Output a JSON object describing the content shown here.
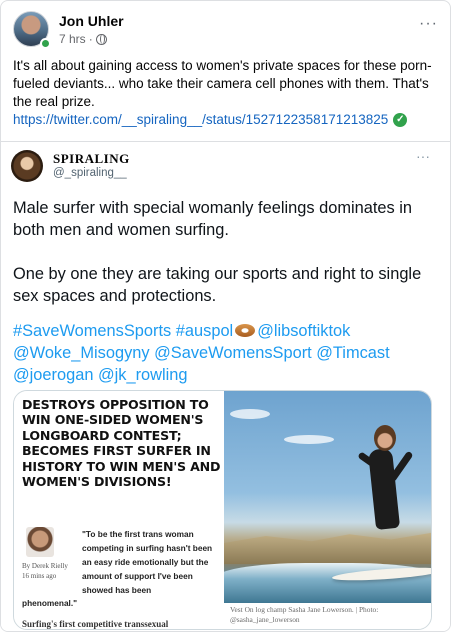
{
  "post": {
    "author": "Jon Uhler",
    "time": "7 hrs",
    "separator": "·",
    "text": "It's all about gaining access to women's private spaces for these porn-fueled deviants... who take their camera cell phones with them. That's the real prize.",
    "link": "https://twitter.com/__spiraling__/status/1527122358171213825",
    "more": "···"
  },
  "tweet": {
    "name": "SPIRALING",
    "handle": "@_spiraling__",
    "more": "···",
    "paragraph1": "Male surfer with special womanly feelings dominates in both men and women surfing.",
    "paragraph2": "One by one they are taking our sports and right to single sex spaces and protections.",
    "tags_line1_a": "#SaveWomensSports",
    "tags_line1_b": "#auspol",
    "tags_line1_c": "@libsoftiktok",
    "tags_line2_a": "@Woke_Misogyny",
    "tags_line2_b": "@SaveWomensSport",
    "tags_line2_c": "@Timcast",
    "tags_line3_a": "@joerogan",
    "tags_line3_b": "@jk_rowling"
  },
  "article": {
    "headline": "DESTROYS OPPOSITION TO WIN ONE-SIDED WOMEN'S LONGBOARD CONTEST; BECOMES FIRST SURFER IN HISTORY TO WIN MEN'S AND WOMEN'S DIVISIONS!",
    "byline_author": "By Derek Rielly",
    "byline_time": "16 mins ago",
    "quote": "\"To be the first trans woman competing in surfing hasn't been an easy ride emotionally but the amount of support I've been showed has been",
    "quote_end": "phenomenal.\"",
    "next_headline": "Surfing's first competitive transsexual",
    "caption": "Vest On log champ Sasha Jane Lowerson. | Photo: @sasha_jane_lowerson"
  },
  "colors": {
    "link_blue": "#1565c0",
    "twitter_blue": "#1d9bf0",
    "verified_green": "#31a24c",
    "meta_gray": "#65676b"
  },
  "icons": [
    "globe-icon",
    "verified-icon",
    "more-icon",
    "bagel-icon",
    "online-dot"
  ]
}
